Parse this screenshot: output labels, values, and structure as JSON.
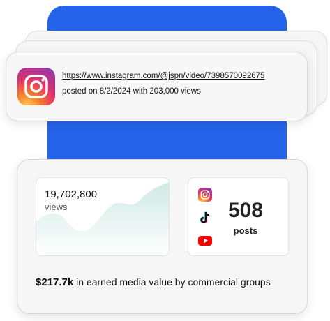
{
  "post": {
    "url": "https://www.instagram.com/@jspn/video/7398570092675",
    "meta": "posted on 8/2/2024 with 203,000 views",
    "platform_icon": "instagram-icon"
  },
  "stats": {
    "views_count": "19,702,800",
    "views_label": "views",
    "posts_count": "508",
    "posts_label": "posts",
    "platform_icons": [
      "instagram-icon",
      "tiktok-icon",
      "youtube-icon"
    ],
    "earned_value": "$217.7k",
    "earned_text": " in earned media value by commercial groups"
  },
  "colors": {
    "panel_blue": "#2563eb",
    "chart_fill": "#d8efec",
    "youtube_red": "#ff0000"
  }
}
